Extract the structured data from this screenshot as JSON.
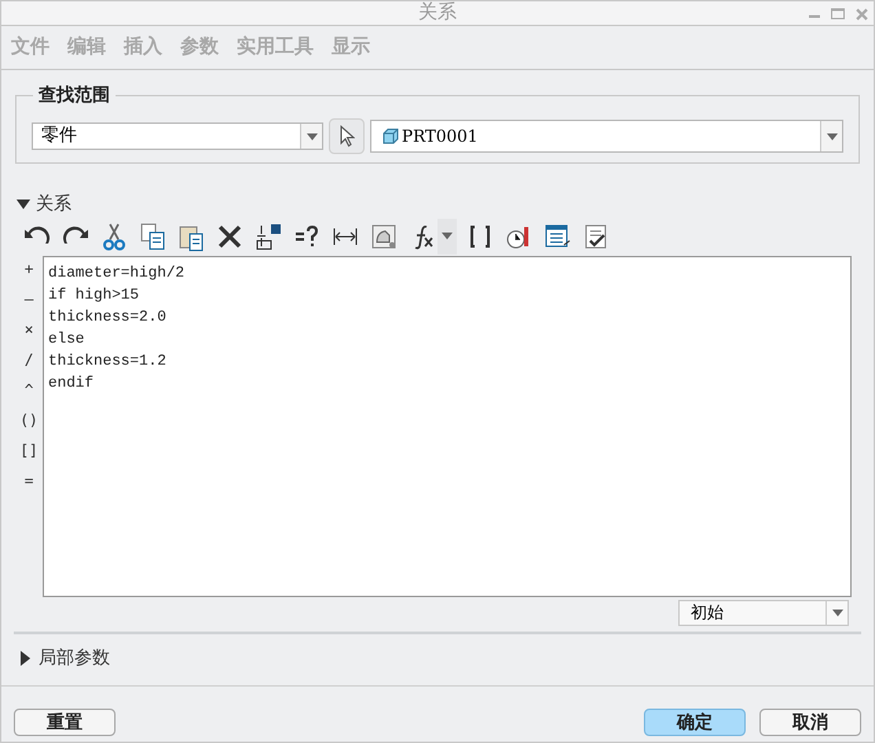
{
  "window": {
    "title": "关系",
    "active": false
  },
  "menu": [
    {
      "label": "文件",
      "disabled": true
    },
    {
      "label": "编辑",
      "disabled": true
    },
    {
      "label": "插入",
      "disabled": true
    },
    {
      "label": "参数",
      "disabled": true
    },
    {
      "label": "实用工具",
      "disabled": true
    },
    {
      "label": "显示",
      "disabled": true
    }
  ],
  "search_scope": {
    "title": "查找范围",
    "type_value": "零件",
    "object_value": "PRT0001"
  },
  "relations": {
    "title": "关系",
    "expanded": true,
    "operators": [
      "+",
      "–",
      "×",
      "/",
      "^",
      "()",
      "[]",
      "="
    ],
    "lines": [
      "diameter=high/2",
      "if high>15",
      "thickness=2.0",
      "else",
      "thickness=1.2",
      "endif"
    ],
    "sort_value": "初始"
  },
  "local_params": {
    "title": "局部参数",
    "expanded": false
  },
  "buttons": [
    {
      "label": "重置",
      "kind": "normal"
    },
    {
      "label": "确定",
      "kind": "default"
    },
    {
      "label": "取消",
      "kind": "normal"
    }
  ]
}
